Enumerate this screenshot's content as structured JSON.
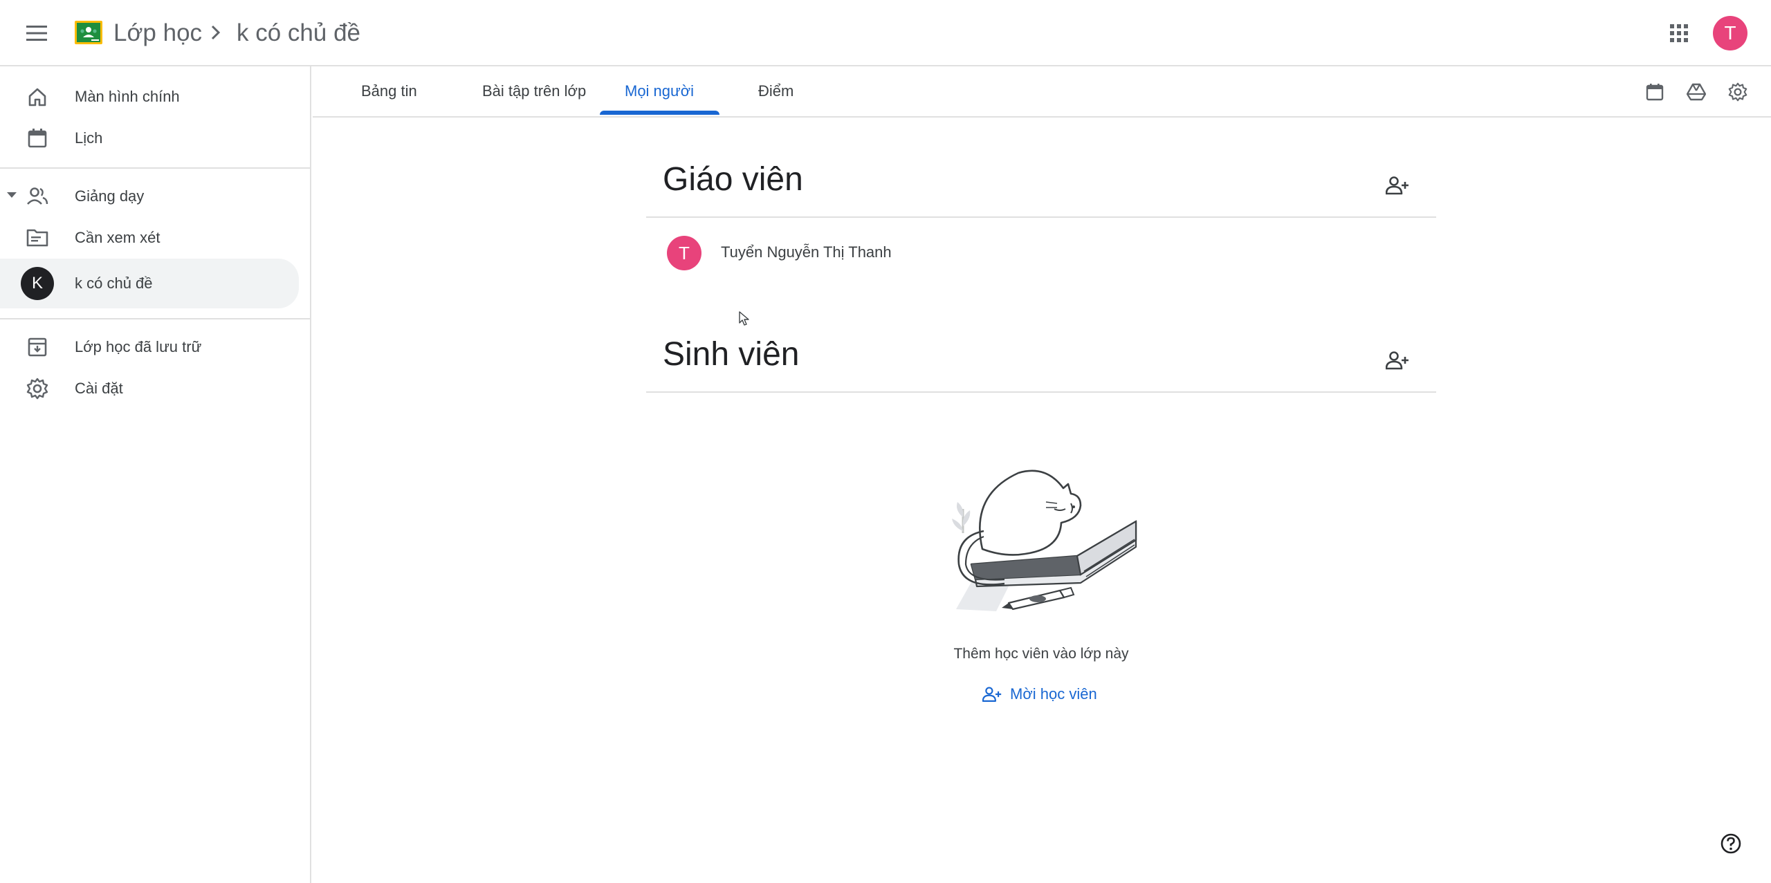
{
  "header": {
    "app_name": "Lớp học",
    "separator": "›",
    "class_name": "k có chủ đề",
    "user_initial": "T"
  },
  "sidebar": {
    "items": [
      {
        "label": "Màn hình chính",
        "icon": "home-icon"
      },
      {
        "label": "Lịch",
        "icon": "calendar-icon"
      },
      {
        "label": "Giảng dạy",
        "icon": "people-icon"
      },
      {
        "label": "Cần xem xét",
        "icon": "review-folder-icon"
      },
      {
        "label": "k có chủ đề",
        "initial": "K"
      },
      {
        "label": "Lớp học đã lưu trữ",
        "icon": "archive-icon"
      },
      {
        "label": "Cài đặt",
        "icon": "gear-icon"
      }
    ]
  },
  "tabs": [
    {
      "label": "Bảng tin"
    },
    {
      "label": "Bài tập trên lớp"
    },
    {
      "label": "Mọi người",
      "active": true
    },
    {
      "label": "Điểm"
    }
  ],
  "teachers": {
    "title": "Giáo viên",
    "list": [
      {
        "initial": "T",
        "name": "Tuyển Nguyễn Thị Thanh"
      }
    ]
  },
  "students": {
    "title": "Sinh viên",
    "empty_text": "Thêm học viên vào lớp này",
    "invite_label": "Mời học viên"
  },
  "colors": {
    "accent": "#1967d2",
    "avatar_pink": "#e8437b",
    "class_avatar": "#202124",
    "divider": "#e0e0e0",
    "active_bg": "#f1f3f4",
    "logo_green": "#1e8e3e",
    "logo_yellow": "#fbbc04"
  }
}
